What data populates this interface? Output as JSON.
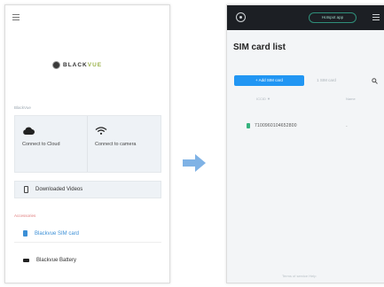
{
  "left": {
    "logo": {
      "text": "BLACKVUE",
      "accent_part": "VUE"
    },
    "sections": {
      "blackvue": "BlackVue",
      "accessories": "Accessories"
    },
    "tiles": [
      {
        "label": "Connect to Cloud",
        "icon": "cloud-icon"
      },
      {
        "label": "Connect to camera",
        "icon": "wifi-icon"
      }
    ],
    "rows": {
      "downloaded": "Downloaded Videos",
      "sim": "Blackvue SIM card",
      "battery": "Blackvue Battery"
    }
  },
  "right": {
    "topbar": {
      "pill": "Hotspot app"
    },
    "title": "SIM card list",
    "add_button": "+ Add SIM card",
    "sim_type": "1 SIM card",
    "list_header": {
      "left": "ICCID ▼",
      "right": "Name"
    },
    "sim_entry": {
      "number": "7100960104652800",
      "name": "-"
    },
    "footer": "Terms of service   Help"
  },
  "colors": {
    "accent_blue": "#2196f3",
    "sim_green": "#36b37e",
    "topbar_bg": "#1c1f24",
    "arrow": "#7fb2e5"
  }
}
